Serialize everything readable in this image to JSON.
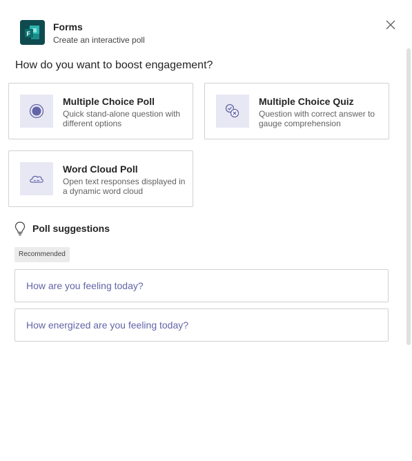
{
  "header": {
    "app_name": "Forms",
    "subtitle": "Create an interactive poll",
    "close_icon": "close-icon",
    "brand_color": "#0f4a4f"
  },
  "question": "How do you want to boost engagement?",
  "options": [
    {
      "title": "Multiple Choice Poll",
      "description": "Quick stand-alone question with different options",
      "icon": "radio-button-icon"
    },
    {
      "title": "Multiple Choice Quiz",
      "description": "Question with correct answer to gauge comprehension",
      "icon": "quiz-check-icon"
    },
    {
      "title": "Word Cloud Poll",
      "description": "Open text responses displayed in a dynamic word cloud",
      "icon": "word-cloud-icon"
    }
  ],
  "suggestions": {
    "label": "Poll suggestions",
    "icon": "lightbulb-icon",
    "badge": "Recommended",
    "items": [
      "How are you feeling today?",
      "How energized are you feeling today?"
    ],
    "link_color": "#6264a7"
  },
  "accent_color": "#6264a7"
}
